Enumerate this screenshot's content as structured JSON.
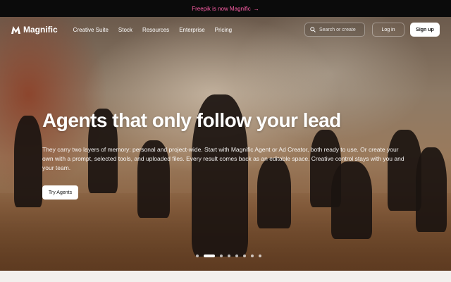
{
  "announcement": {
    "text": "Freepik is now Magnific",
    "arrow": "→"
  },
  "nav": {
    "brand": "Magnific",
    "menu": [
      "Creative Suite",
      "Stock",
      "Resources",
      "Enterprise",
      "Pricing"
    ],
    "search_placeholder": "Search or create",
    "login": "Log in",
    "signup": "Sign up"
  },
  "hero": {
    "headline": "Agents that only follow your lead",
    "subtext": "They carry two layers of memory: personal and project-wide. Start with Magnific Agent or Ad Creator, both ready to use. Or create your own with a prompt, selected tools, and uploaded files. Every result comes back as an editable space. Creative control stays with you and your team.",
    "cta": "Try Agents",
    "carousel": {
      "total": 8,
      "active": 1
    }
  },
  "colors": {
    "announcement": "#ff5fa8",
    "bar": "#0b0b0b"
  },
  "icons": {
    "logo": "magnific-logo-icon",
    "search": "search-icon"
  }
}
